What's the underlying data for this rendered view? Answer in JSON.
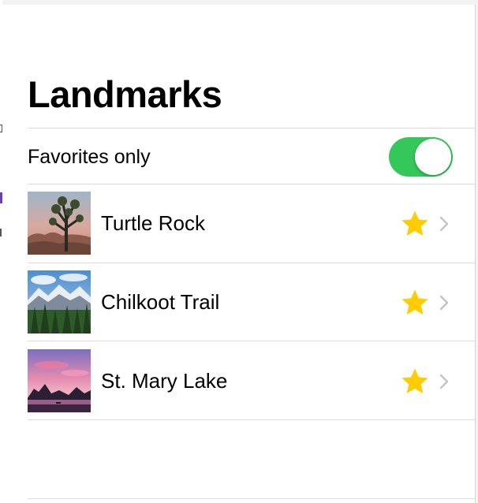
{
  "nav": {
    "title": "Landmarks"
  },
  "filter": {
    "label": "Favorites only",
    "enabled": true,
    "on_color": "#34c759"
  },
  "landmarks": [
    {
      "name": "Turtle Rock",
      "favorite": true,
      "thumbnail": "joshua-tree-desert-photo"
    },
    {
      "name": "Chilkoot Trail",
      "favorite": true,
      "thumbnail": "mountain-forest-photo"
    },
    {
      "name": "St. Mary Lake",
      "favorite": true,
      "thumbnail": "sunset-lake-photo"
    }
  ],
  "colors": {
    "star": "#ffcc00",
    "chevron": "#c4c4c7",
    "separator": "#dcdcdc"
  },
  "icons": {
    "favorite": "star-icon",
    "disclosure": "chevron-right-icon"
  }
}
